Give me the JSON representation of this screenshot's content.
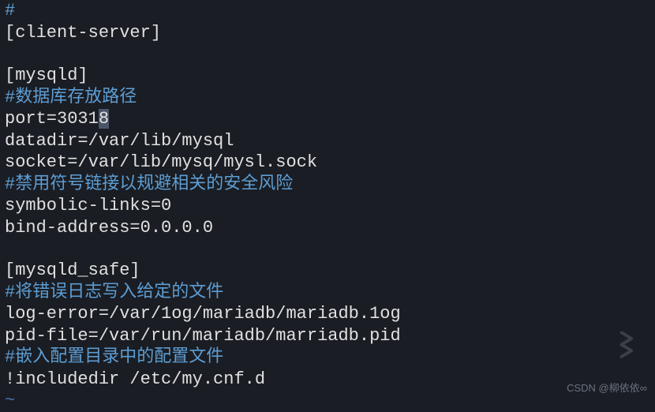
{
  "config": {
    "l1_hash": "#",
    "l2_client_server": "[client-server]",
    "l3_blank": "",
    "l4_mysqld": "[mysqld]",
    "l5_comment_db_path": "#数据库存放路径",
    "l6_port_prefix": "port=3031",
    "l6_port_highlight": "8",
    "l7_datadir": "datadir=/var/lib/mysql",
    "l8_socket": "socket=/var/lib/mysq/mysl.sock",
    "l9_comment_symlink": "#禁用符号链接以规避相关的安全风险",
    "l10_symbolic": "symbolic-links=0",
    "l11_bind": "bind-address=0.0.0.0",
    "l12_blank": "",
    "l13_mysqld_safe": "[mysqld_safe]",
    "l14_comment_logerr": "#将错误日志写入给定的文件",
    "l15_logerror": "log-error=/var/1og/mariadb/mariadb.1og",
    "l16_pidfile": "pid-file=/var/run/mariadb/marriadb.pid",
    "l17_comment_include": "#嵌入配置目录中的配置文件",
    "l18_includedir": "!includedir /etc/my.cnf.d",
    "l19_tilde": "~"
  },
  "watermark": "CSDN @柳依依∞"
}
